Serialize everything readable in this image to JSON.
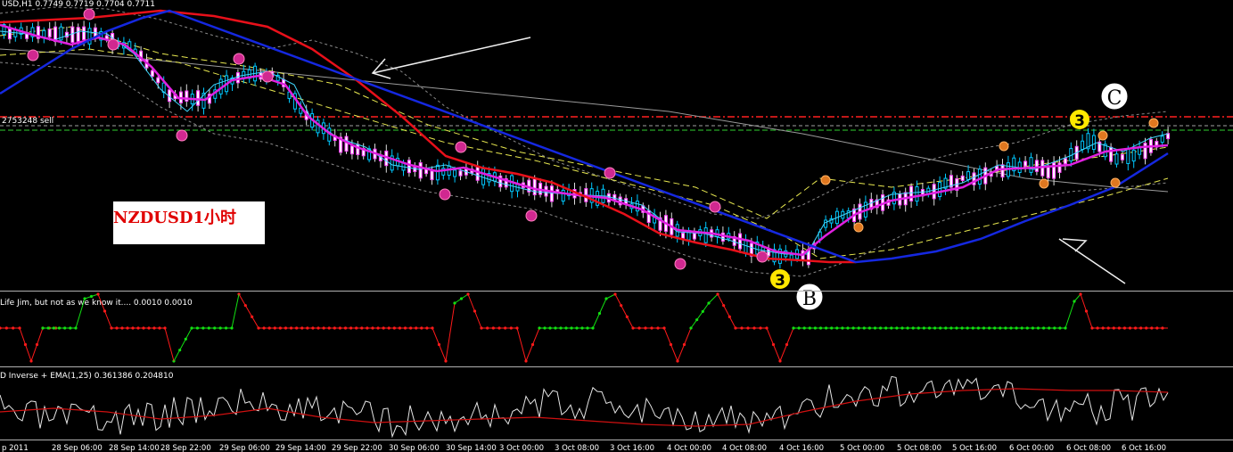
{
  "header": {
    "symbol_info": "USD,H1  0.7749 0.7719 0.7704 0.7711",
    "sell_label": "2753248 sell"
  },
  "overlay_label": "NZDUSD1小时",
  "annotations": {
    "b": "B",
    "c": "C",
    "three": "3"
  },
  "indicators": {
    "jim": "Life Jim, but not as we know it.... 0.0010 0.0010",
    "inverse": "D Inverse + EMA(1,25) 0.361386 0.204810"
  },
  "time_axis": [
    "p 2011",
    "28 Sep 06:00",
    "28 Sep 14:00",
    "28 Sep 22:00",
    "29 Sep 06:00",
    "29 Sep 14:00",
    "29 Sep 22:00",
    "30 Sep 06:00",
    "30 Sep 14:00",
    "3 Oct 00:00",
    "3 Oct 08:00",
    "3 Oct 16:00",
    "4 Oct 00:00",
    "4 Oct 08:00",
    "4 Oct 16:00",
    "5 Oct 00:00",
    "5 Oct 08:00",
    "5 Oct 16:00",
    "6 Oct 00:00",
    "6 Oct 08:00",
    "6 Oct 16:00"
  ],
  "colors": {
    "background": "#000000",
    "ma_red": "#e8101a",
    "ma_blue": "#1528e0",
    "ma_magenta": "#e020e0",
    "candle_bull": "#00c8ff",
    "candle_bear": "#ffffff",
    "signal_green": "#12e012",
    "signal_red": "#ff1a1a",
    "inverse_white": "#e6e6e6",
    "ema_red": "#d01010"
  }
}
